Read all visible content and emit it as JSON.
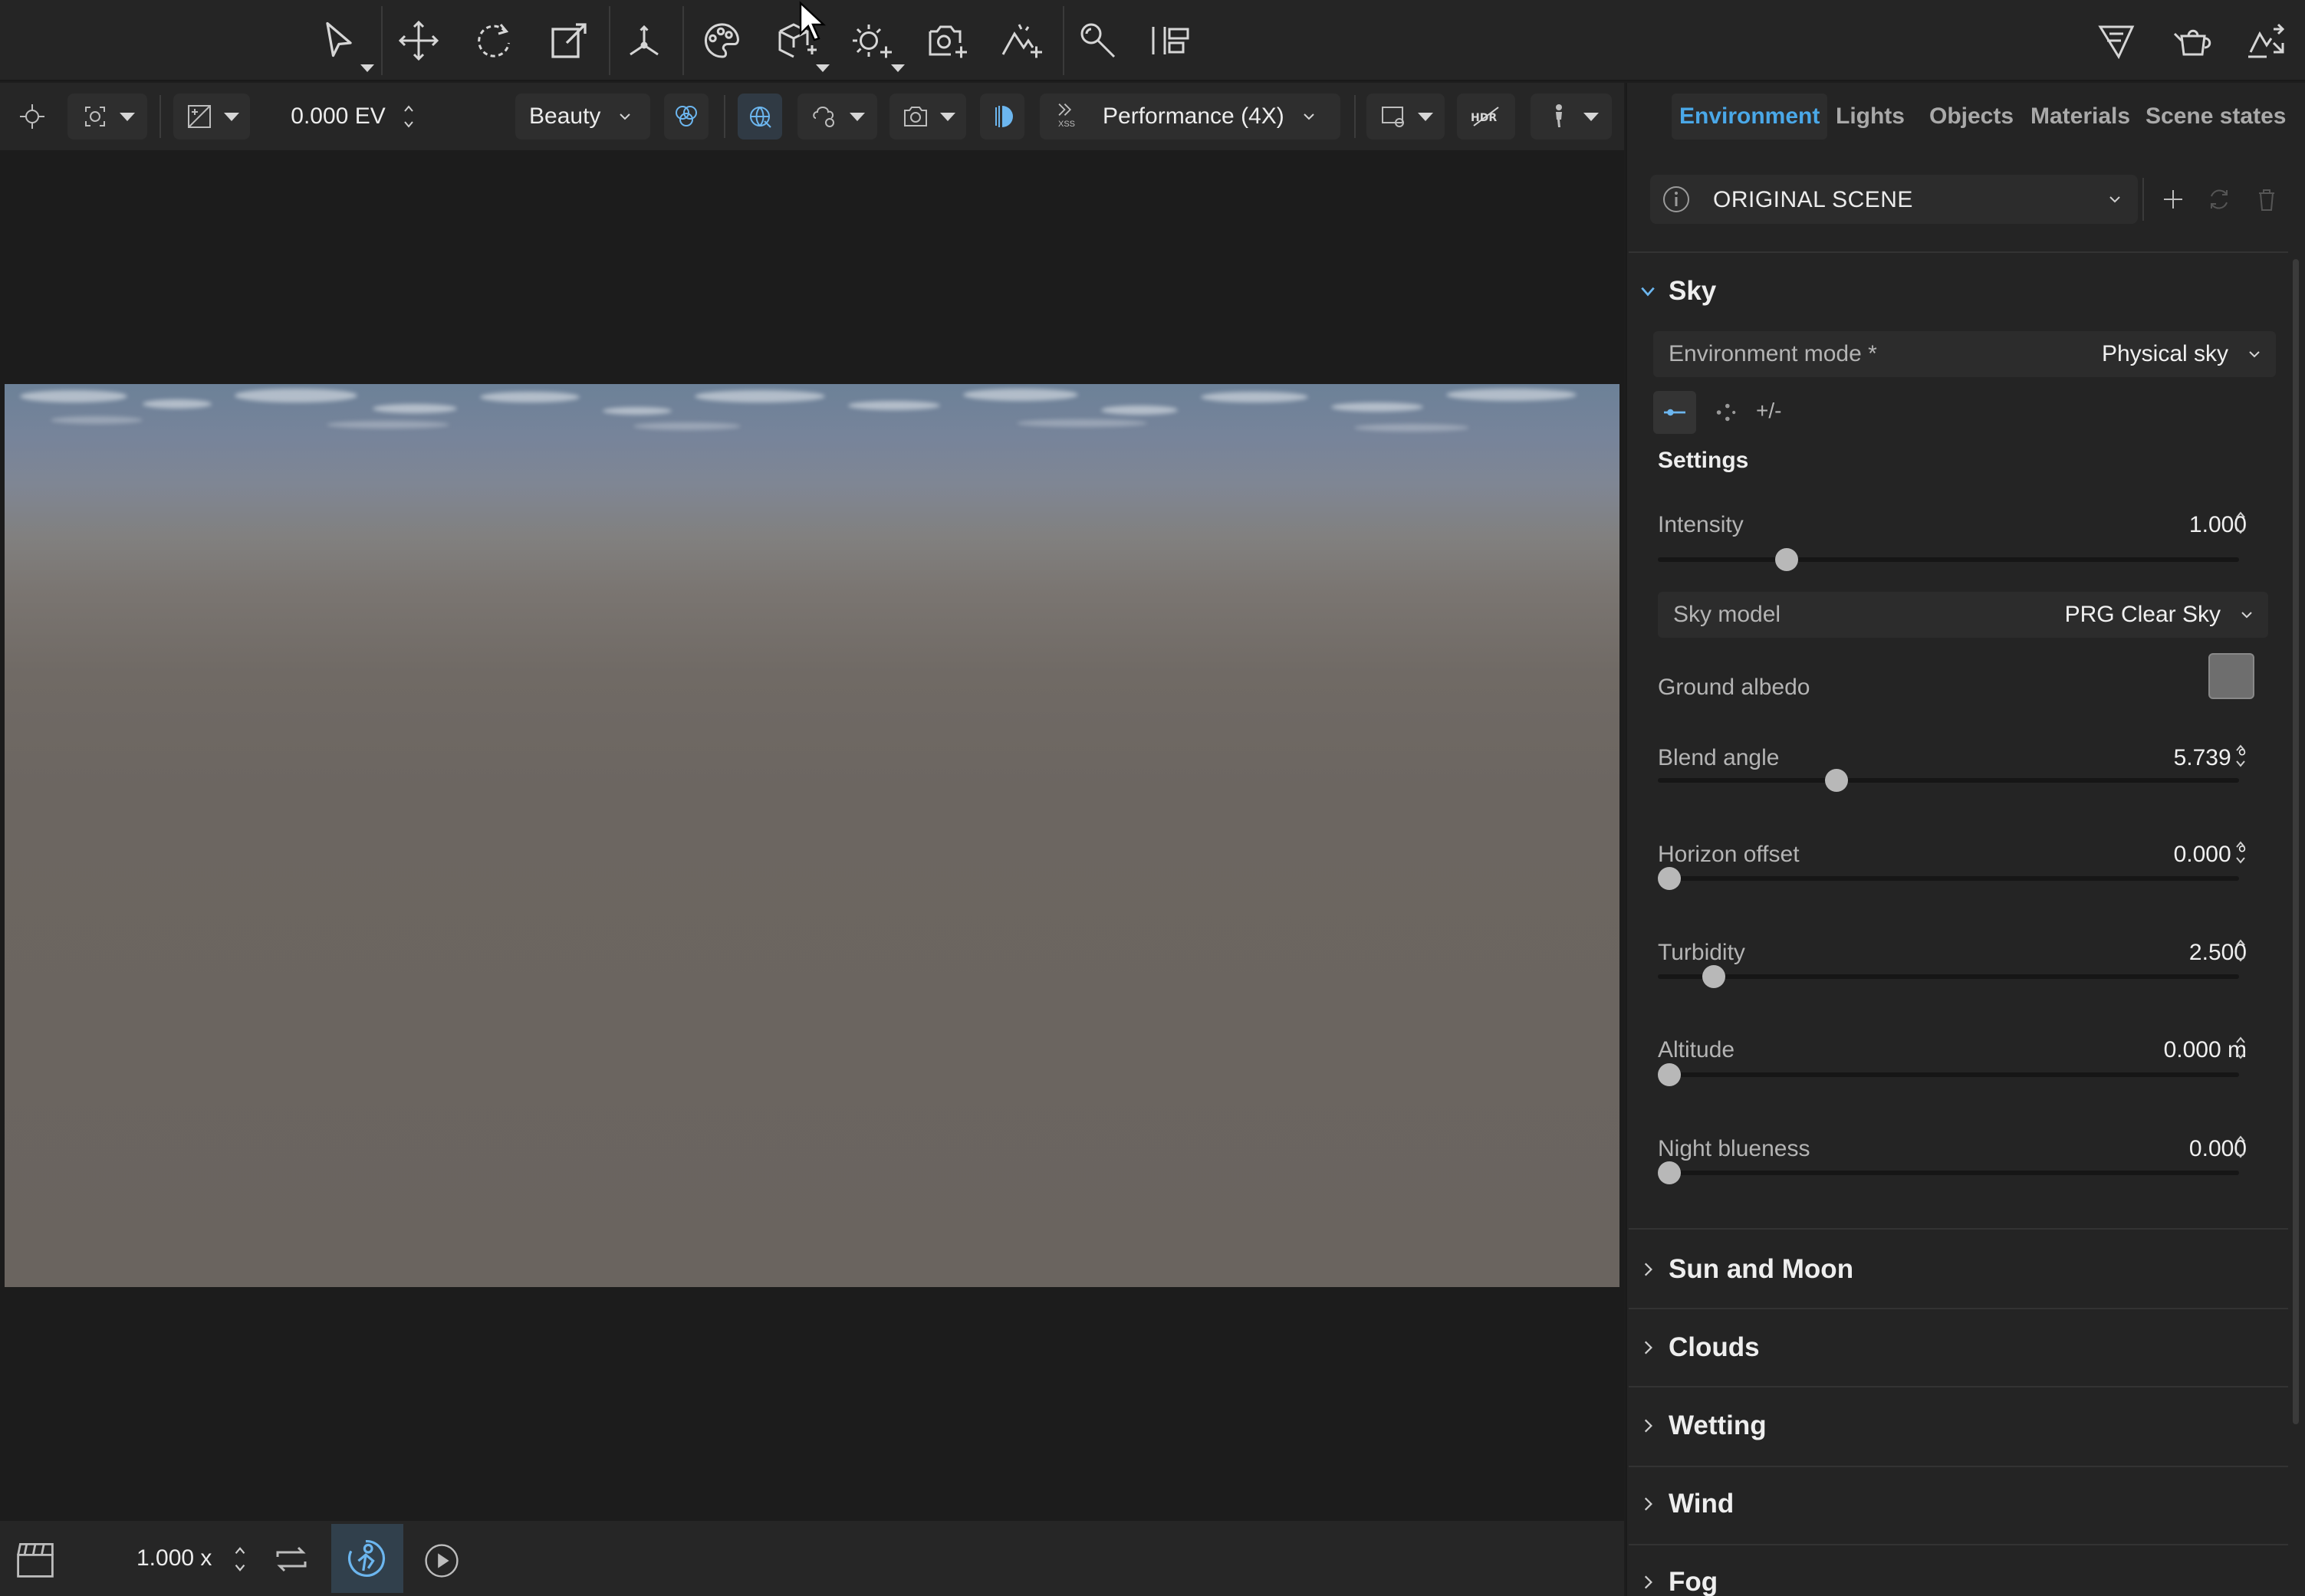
{
  "toolbar": {
    "icons": [
      "select-icon",
      "move-icon",
      "rotate-icon",
      "scale-icon",
      "pivot-icon",
      "material-palette-icon",
      "add-geometry-icon",
      "add-light-icon",
      "add-camera-icon",
      "add-environment-icon",
      "inspector-icon",
      "align-icon",
      "vred-logo-icon",
      "teapot-icon",
      "export-icon"
    ]
  },
  "subbar": {
    "exposure_value": "0.000 EV",
    "render_pass": "Beauty",
    "quality_mode": "Performance (4X)",
    "dlss_badge": "XSS"
  },
  "bottombar": {
    "speed": "1.000 x"
  },
  "panel": {
    "tabs": [
      {
        "label": "Environment",
        "active": true
      },
      {
        "label": "Lights",
        "active": false
      },
      {
        "label": "Objects",
        "active": false
      },
      {
        "label": "Materials",
        "active": false
      },
      {
        "label": "Scene states",
        "active": false
      }
    ],
    "scene_state": "ORIGINAL SCENE",
    "sky": {
      "title": "Sky",
      "environment_mode_label": "Environment mode *",
      "environment_mode_value": "Physical sky",
      "settings_tabs": [
        "•-",
        "·:",
        "+/-"
      ],
      "settings_title": "Settings",
      "intensity": {
        "label": "Intensity",
        "value": "1.000",
        "fraction": 0.21
      },
      "sky_model": {
        "label": "Sky model",
        "value": "PRG Clear Sky"
      },
      "ground_albedo": {
        "label": "Ground albedo",
        "color": "#6e6e6e"
      },
      "blend_angle": {
        "label": "Blend angle",
        "value": "5.739 °",
        "fraction": 0.3
      },
      "horizon_offset": {
        "label": "Horizon offset",
        "value": "0.000 °",
        "fraction": 0.0
      },
      "turbidity": {
        "label": "Turbidity",
        "value": "2.500",
        "fraction": 0.08
      },
      "altitude": {
        "label": "Altitude",
        "value": "0.000 m",
        "fraction": 0.0
      },
      "night_blueness": {
        "label": "Night blueness",
        "value": "0.000",
        "fraction": 0.0
      }
    },
    "sections": [
      "Sun and Moon",
      "Clouds",
      "Wetting",
      "Wind",
      "Fog"
    ]
  },
  "colors": {
    "accent": "#4aa8e8",
    "panel_bg": "#242424",
    "toolbar_bg": "#252525"
  }
}
